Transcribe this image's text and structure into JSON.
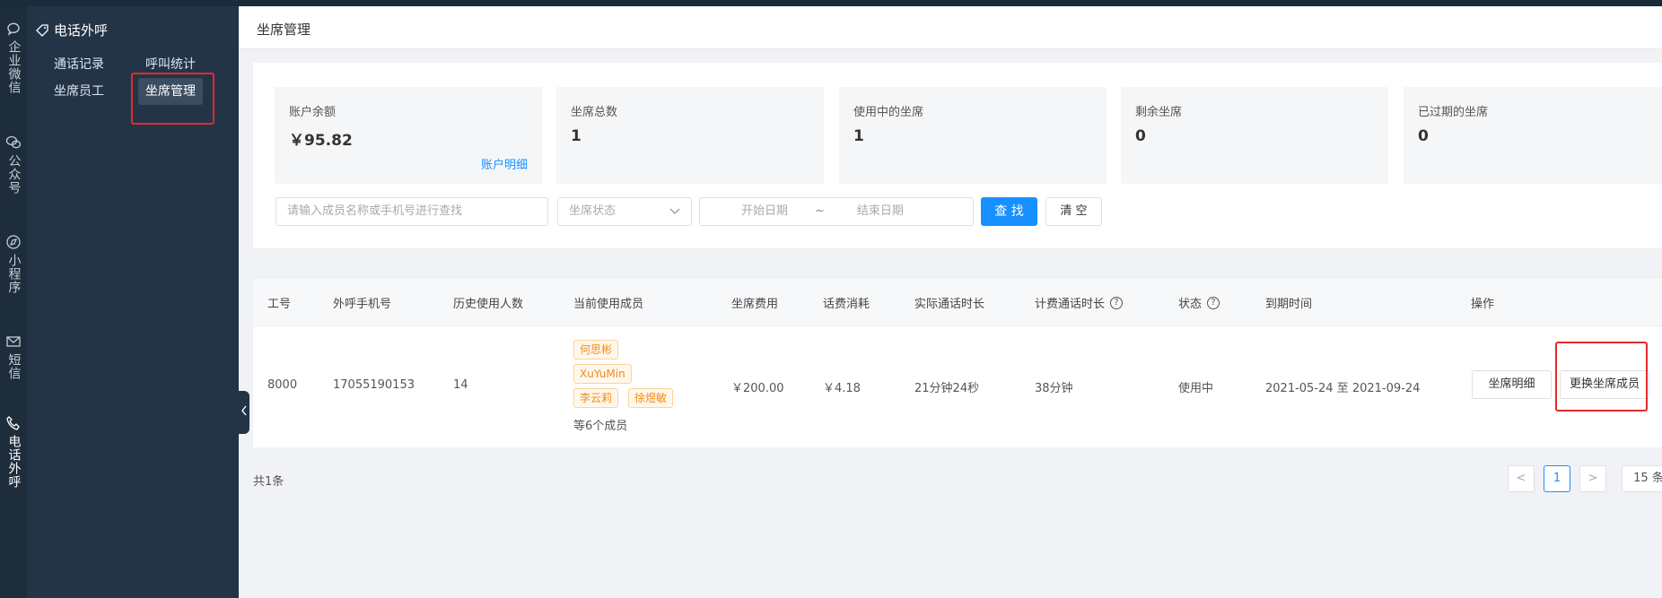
{
  "rail": [
    {
      "icon": "chat-bubble-icon",
      "label": "企业微信"
    },
    {
      "icon": "wechat-icon",
      "label": "公众号"
    },
    {
      "icon": "compass-icon",
      "label": "小程序"
    },
    {
      "icon": "envelope-icon",
      "label": "短信"
    },
    {
      "icon": "phone-icon",
      "label": "电话外呼"
    }
  ],
  "subnav": {
    "title": "电话外呼",
    "links": [
      "通话记录",
      "呼叫统计",
      "坐席员工",
      "坐席管理"
    ],
    "active": "坐席管理"
  },
  "header": {
    "title": "坐席管理"
  },
  "stats": [
    {
      "label": "账户余额",
      "value": "￥95.82",
      "link": "账户明细"
    },
    {
      "label": "坐席总数",
      "value": "1"
    },
    {
      "label": "使用中的坐席",
      "value": "1"
    },
    {
      "label": "剩余坐席",
      "value": "0"
    },
    {
      "label": "已过期的坐席",
      "value": "0"
    }
  ],
  "filters": {
    "search_placeholder": "请输入成员名称或手机号进行查找",
    "status_placeholder": "坐席状态",
    "start_date": "开始日期",
    "date_sep": "~",
    "end_date": "结束日期",
    "search_btn": "查 找",
    "clear_btn": "清 空"
  },
  "table": {
    "headers": [
      "工号",
      "外呼手机号",
      "历史使用人数",
      "当前使用成员",
      "坐席费用",
      "话费消耗",
      "实际通话时长",
      "计费通话时长",
      "状态",
      "到期时间",
      "操作"
    ],
    "row": {
      "id": "8000",
      "phone": "17055190153",
      "history_count": "14",
      "members": [
        "何思彬",
        "XuYuMin",
        "李云莉",
        "徐煜敏"
      ],
      "members_more": "等6个成员",
      "fee": "￥200.00",
      "call_cost": "￥4.18",
      "actual_duration": "21分钟24秒",
      "billed_duration": "38分钟",
      "status": "使用中",
      "expire": "2021-05-24 至 2021-09-24",
      "action_detail": "坐席明细",
      "action_replace": "更换坐席成员"
    }
  },
  "footer": {
    "total": "共1条",
    "prev": "<",
    "page": "1",
    "next": ">",
    "page_size": "15 条"
  },
  "colors": {
    "primary": "#1890ff",
    "sidebar": "#243447",
    "highlight": "#e32a2a",
    "tag": "#f08c14"
  }
}
